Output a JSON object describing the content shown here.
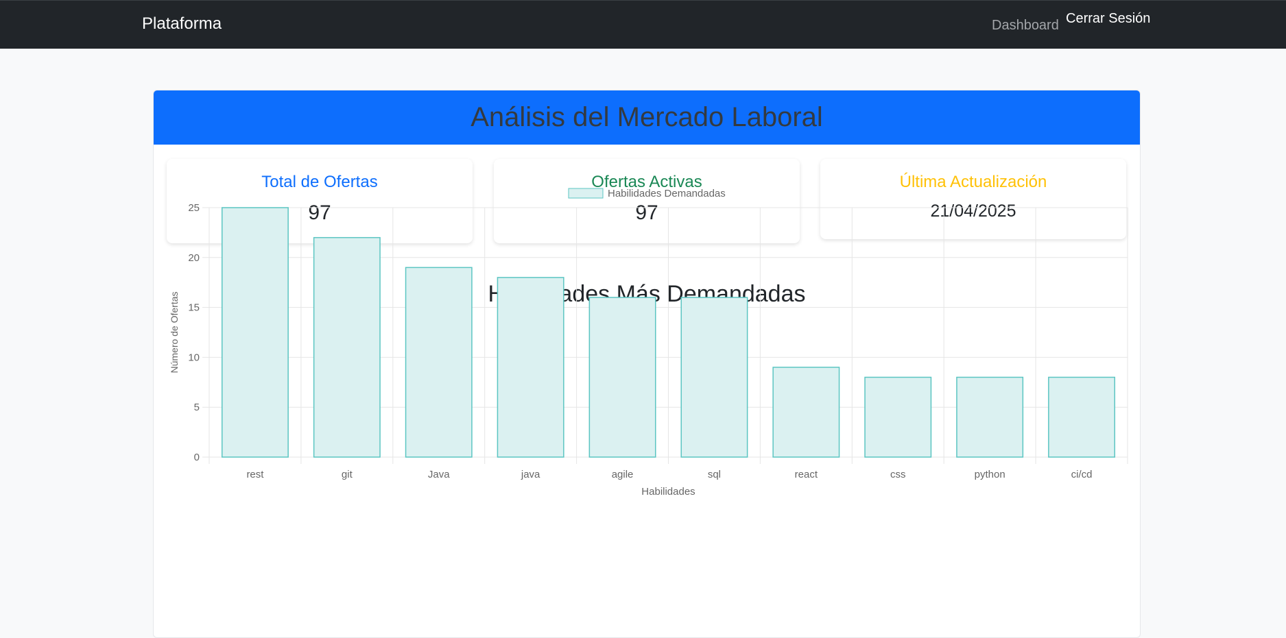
{
  "navbar": {
    "brand": "Plataforma",
    "links": {
      "dashboard": "Dashboard",
      "logout": "Cerrar Sesión"
    }
  },
  "header": {
    "title": "Análisis del Mercado Laboral"
  },
  "stats": {
    "total": {
      "label": "Total de Ofertas",
      "value": "97",
      "color": "#0d6efd"
    },
    "active": {
      "label": "Ofertas Activas",
      "value": "97",
      "color": "#198754"
    },
    "updated": {
      "label": "Última Actualización",
      "value": "21/04/2025",
      "color": "#ffc107"
    }
  },
  "chart_section": {
    "title": "Habilidades Más Demandadas"
  },
  "chart_data": {
    "type": "bar",
    "title": "",
    "categories": [
      "rest",
      "git",
      "Java",
      "java",
      "agile",
      "sql",
      "react",
      "css",
      "python",
      "ci/cd"
    ],
    "series": [
      {
        "name": "Habilidades Demandadas",
        "values": [
          25,
          22,
          19,
          18,
          16,
          16,
          9,
          8,
          8,
          8
        ]
      }
    ],
    "xlabel": "Habilidades",
    "ylabel": "Número de Ofertas",
    "ylim": [
      0,
      25
    ],
    "yticks": [
      0,
      5,
      10,
      15,
      20,
      25
    ],
    "grid": true,
    "legend": "top-center",
    "bar_fill": "#dbf1f1",
    "bar_stroke": "#5bc5c2"
  }
}
